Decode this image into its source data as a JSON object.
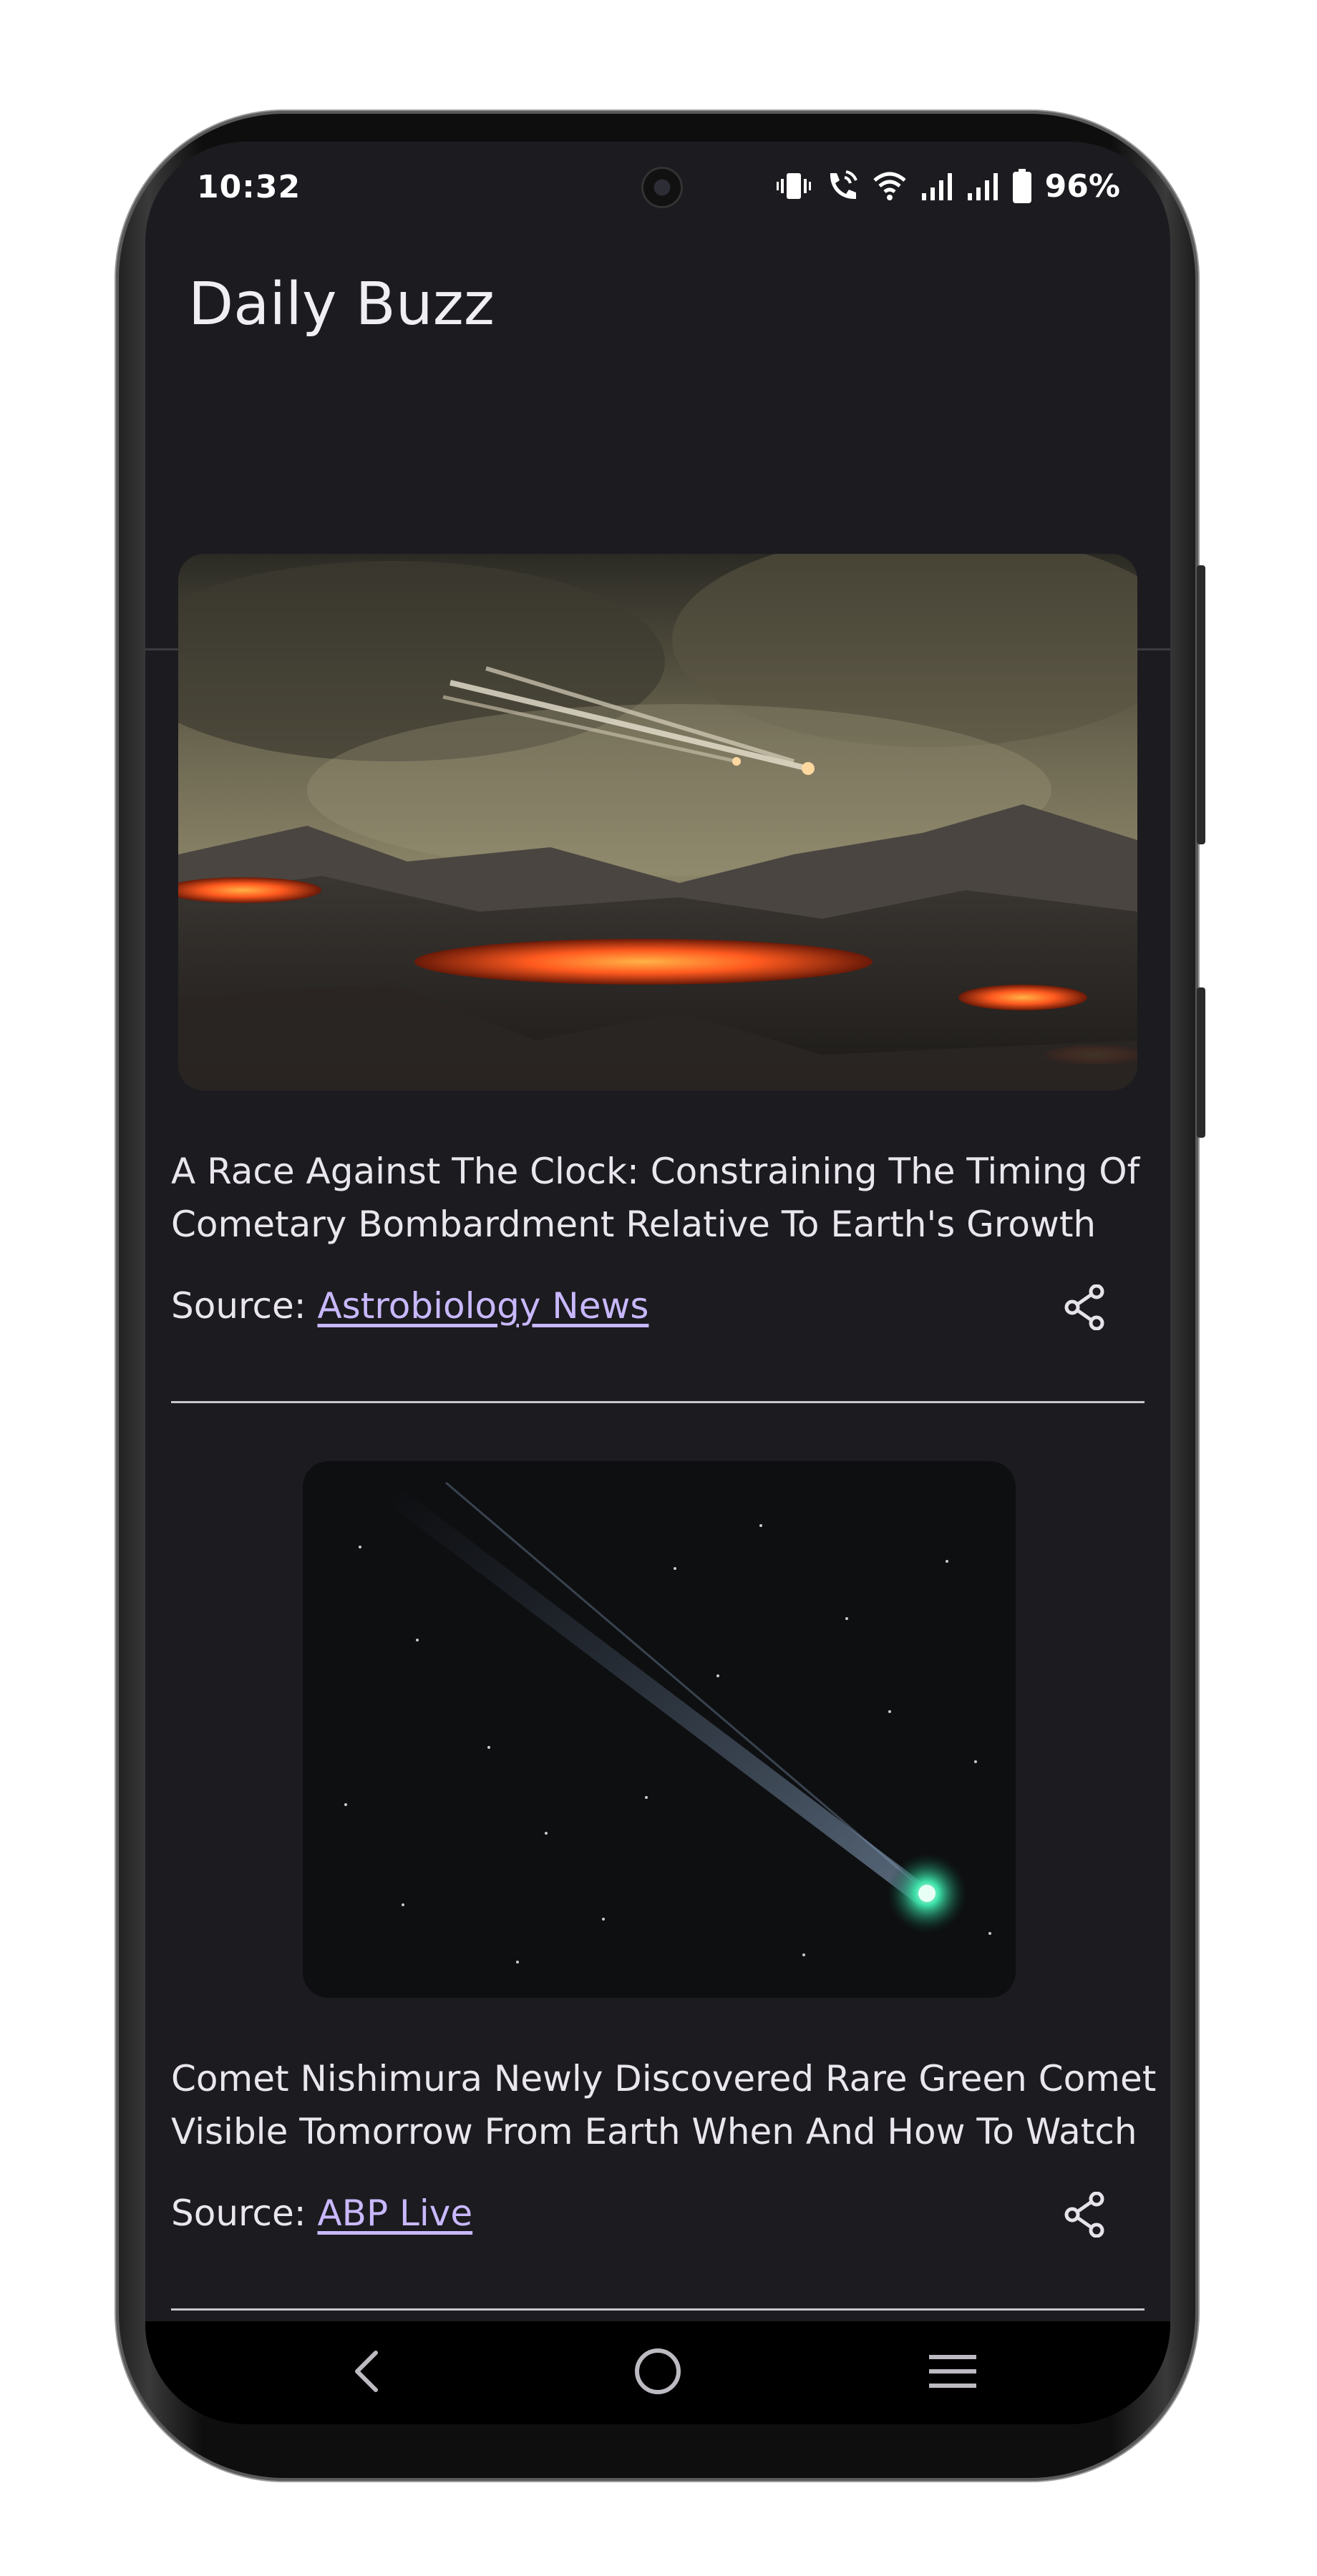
{
  "status_bar": {
    "time": "10:32",
    "battery": "96%",
    "icons": [
      "vibrate-icon",
      "wifi-calling-icon",
      "wifi-icon",
      "signal-icon",
      "signal-icon",
      "battery-icon"
    ]
  },
  "app": {
    "title": "Daily Buzz"
  },
  "tabs": [
    {
      "icon": "laptop-icon",
      "selected": false
    },
    {
      "icon": "briefcase-icon",
      "selected": false
    },
    {
      "icon": "flask-icon",
      "selected": true
    },
    {
      "icon": "menu-icon",
      "selected": false
    }
  ],
  "articles": [
    {
      "title": "A Race Against The Clock: Constraining The Timing Of Cometary Bombardment Relative To Earth's Growth",
      "source_prefix": "Source: ",
      "source": "Astrobiology News"
    },
    {
      "title": "Comet Nishimura Newly Discovered Rare Green Comet Visible Tomorrow From Earth When And How To Watch",
      "source_prefix": "Source: ",
      "source": "ABP Live"
    }
  ],
  "nav": {
    "icons": [
      "back-icon",
      "home-icon",
      "recents-icon"
    ]
  },
  "colors": {
    "background": "#1c1b1f",
    "accent": "#c9b8ff",
    "text": "#e9e6ee"
  }
}
